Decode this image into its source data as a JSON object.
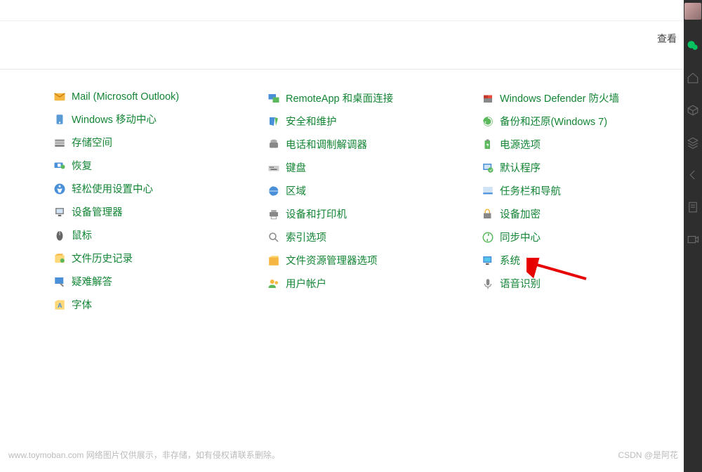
{
  "header": {
    "view_label": "查看"
  },
  "columns": [
    [
      {
        "icon": "mail-icon",
        "label": "Mail (Microsoft Outlook)"
      },
      {
        "icon": "mobility-icon",
        "label": "Windows 移动中心"
      },
      {
        "icon": "storage-icon",
        "label": "存储空间"
      },
      {
        "icon": "recovery-icon",
        "label": "恢复"
      },
      {
        "icon": "ease-access-icon",
        "label": "轻松使用设置中心"
      },
      {
        "icon": "device-manager-icon",
        "label": "设备管理器"
      },
      {
        "icon": "mouse-icon",
        "label": "鼠标"
      },
      {
        "icon": "file-history-icon",
        "label": "文件历史记录"
      },
      {
        "icon": "troubleshoot-icon",
        "label": "疑难解答"
      },
      {
        "icon": "fonts-icon",
        "label": "字体"
      }
    ],
    [
      {
        "icon": "remoteapp-icon",
        "label": "RemoteApp 和桌面连接"
      },
      {
        "icon": "security-icon",
        "label": "安全和维护"
      },
      {
        "icon": "phone-modem-icon",
        "label": "电话和调制解调器"
      },
      {
        "icon": "keyboard-icon",
        "label": "键盘"
      },
      {
        "icon": "region-icon",
        "label": "区域"
      },
      {
        "icon": "devices-printers-icon",
        "label": "设备和打印机"
      },
      {
        "icon": "indexing-icon",
        "label": "索引选项"
      },
      {
        "icon": "explorer-options-icon",
        "label": "文件资源管理器选项"
      },
      {
        "icon": "user-accounts-icon",
        "label": "用户帐户"
      }
    ],
    [
      {
        "icon": "defender-icon",
        "label": "Windows Defender 防火墙"
      },
      {
        "icon": "backup-icon",
        "label": "备份和还原(Windows 7)"
      },
      {
        "icon": "power-icon",
        "label": "电源选项"
      },
      {
        "icon": "default-programs-icon",
        "label": "默认程序"
      },
      {
        "icon": "taskbar-icon",
        "label": "任务栏和导航"
      },
      {
        "icon": "device-encryption-icon",
        "label": "设备加密"
      },
      {
        "icon": "sync-icon",
        "label": "同步中心"
      },
      {
        "icon": "system-icon",
        "label": "系统"
      },
      {
        "icon": "speech-icon",
        "label": "语音识别"
      }
    ]
  ],
  "watermark": {
    "left": "www.toymoban.com 网络图片仅供展示，非存储，如有侵权请联系删除。",
    "right": "CSDN @是阿花"
  },
  "sidebar_icons": [
    "avatar",
    "wechat",
    "home",
    "box",
    "layer",
    "back",
    "doc",
    "video"
  ]
}
